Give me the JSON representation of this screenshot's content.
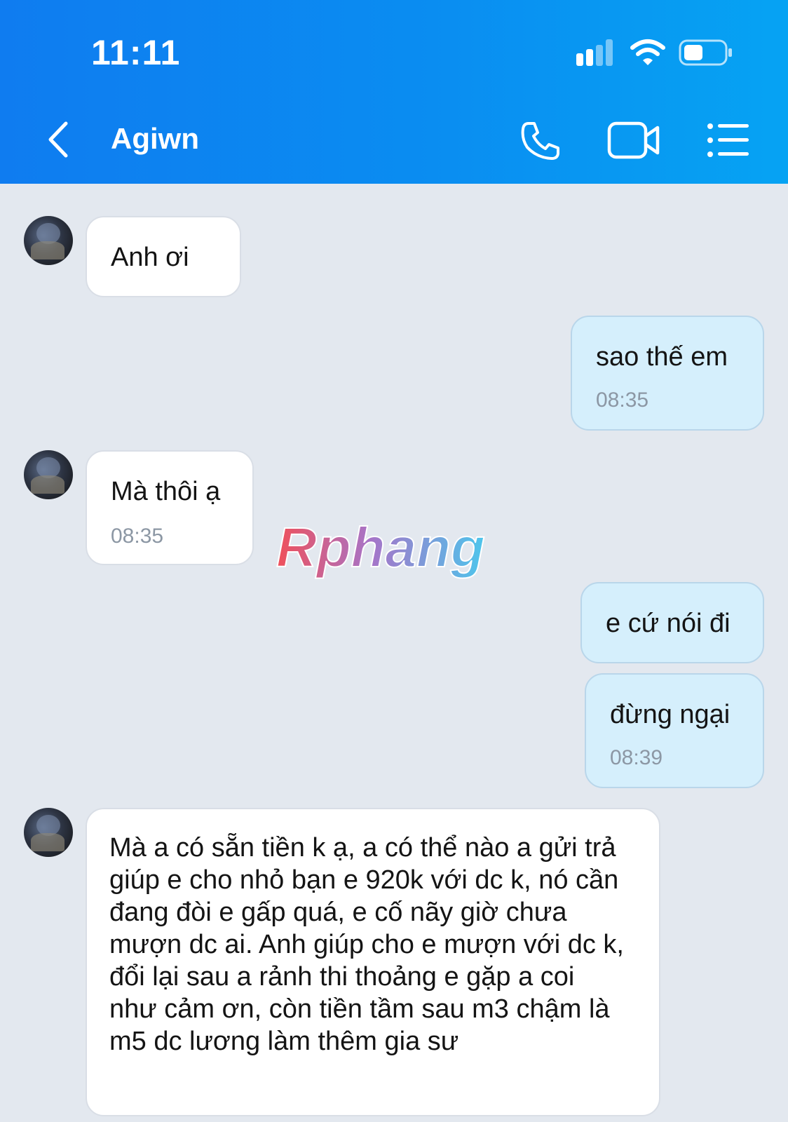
{
  "status_bar": {
    "time": "11:11"
  },
  "header": {
    "contact_name": "Agiwn",
    "icons": [
      "back-icon",
      "phone-icon",
      "video-call-icon",
      "menu-list-icon"
    ],
    "colors": {
      "gradient_start": "#0f7cf0",
      "gradient_end": "#06a3f3"
    }
  },
  "messages": [
    {
      "direction": "in",
      "text": "Anh ơi",
      "time": ""
    },
    {
      "direction": "out",
      "text": "sao thế em",
      "time": "08:35"
    },
    {
      "direction": "in",
      "text": "Mà thôi ạ",
      "time": "08:35"
    },
    {
      "direction": "out",
      "text": "e cứ nói đi",
      "time": ""
    },
    {
      "direction": "out",
      "text": "đừng ngại",
      "time": "08:39"
    },
    {
      "direction": "in",
      "text": "Mà a có sẵn tiền k ạ, a có thể nào a gửi trả giúp e cho nhỏ bạn e 920k với dc k, nó cần đang đòi e gấp quá, e cố nãy giờ chưa mượn dc ai. Anh giúp cho e mượn với dc k, đổi lại sau a rảnh thi thoảng e gặp a coi như cảm ơn, còn tiền tầm sau m3 chậm là m5 dc lương làm thêm gia sư",
      "time": ""
    }
  ],
  "watermark": {
    "text": "Rphang"
  },
  "colors": {
    "chat_background": "#e3e8ef",
    "incoming_bubble": "#ffffff",
    "outgoing_bubble": "#d5effc",
    "timestamp": "#8c97a4"
  }
}
